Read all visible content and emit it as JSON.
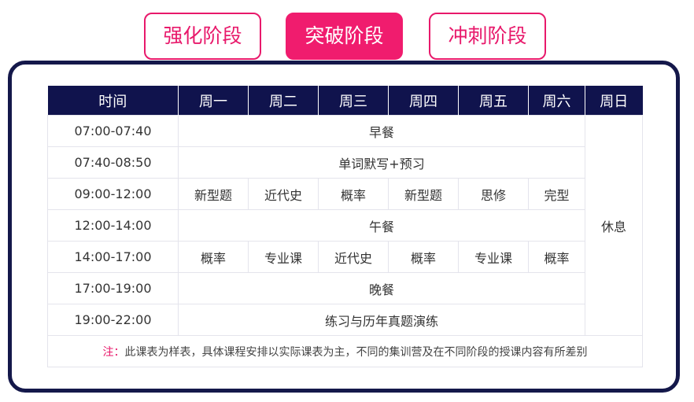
{
  "tabs": [
    {
      "label": "强化阶段",
      "active": false
    },
    {
      "label": "突破阶段",
      "active": true
    },
    {
      "label": "冲刺阶段",
      "active": false
    }
  ],
  "schedule": {
    "headers": [
      "时间",
      "周一",
      "周二",
      "周三",
      "周四",
      "周五",
      "周六",
      "周日"
    ],
    "times": [
      "07:00-07:40",
      "07:40-08:50",
      "09:00-12:00",
      "12:00-14:00",
      "14:00-17:00",
      "17:00-19:00",
      "19:00-22:00"
    ],
    "breakfast": "早餐",
    "vocab": "单词默写+预习",
    "morning": [
      "新型题",
      "近代史",
      "概率",
      "新型题",
      "思修",
      "完型"
    ],
    "lunch": "午餐",
    "afternoon": [
      "概率",
      "专业课",
      "近代史",
      "概率",
      "专业课",
      "概率"
    ],
    "dinner": "晚餐",
    "evening": "练习与历年真题演练",
    "sunday": "休息",
    "note_label": "注：",
    "note_text": "此课表为样表，具体课程安排以实际课表为主，不同的集训营及在不同阶段的授课内容有所差别"
  },
  "colors": {
    "accent": "#f01c6e",
    "navy": "#10134d",
    "grid": "#e4e4ec"
  }
}
